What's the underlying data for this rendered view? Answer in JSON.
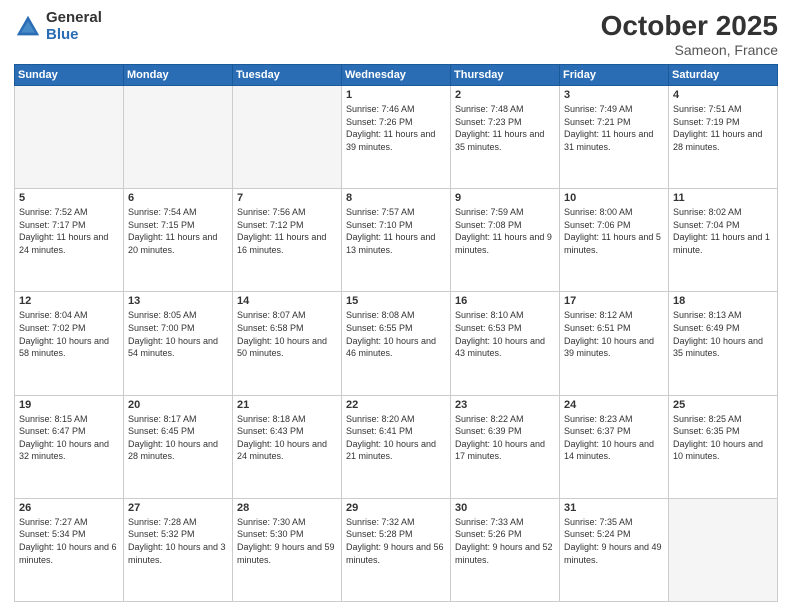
{
  "logo": {
    "general": "General",
    "blue": "Blue"
  },
  "header": {
    "month": "October 2025",
    "location": "Sameon, France"
  },
  "weekdays": [
    "Sunday",
    "Monday",
    "Tuesday",
    "Wednesday",
    "Thursday",
    "Friday",
    "Saturday"
  ],
  "weeks": [
    [
      {
        "day": "",
        "info": ""
      },
      {
        "day": "",
        "info": ""
      },
      {
        "day": "",
        "info": ""
      },
      {
        "day": "1",
        "info": "Sunrise: 7:46 AM\nSunset: 7:26 PM\nDaylight: 11 hours\nand 39 minutes."
      },
      {
        "day": "2",
        "info": "Sunrise: 7:48 AM\nSunset: 7:23 PM\nDaylight: 11 hours\nand 35 minutes."
      },
      {
        "day": "3",
        "info": "Sunrise: 7:49 AM\nSunset: 7:21 PM\nDaylight: 11 hours\nand 31 minutes."
      },
      {
        "day": "4",
        "info": "Sunrise: 7:51 AM\nSunset: 7:19 PM\nDaylight: 11 hours\nand 28 minutes."
      }
    ],
    [
      {
        "day": "5",
        "info": "Sunrise: 7:52 AM\nSunset: 7:17 PM\nDaylight: 11 hours\nand 24 minutes."
      },
      {
        "day": "6",
        "info": "Sunrise: 7:54 AM\nSunset: 7:15 PM\nDaylight: 11 hours\nand 20 minutes."
      },
      {
        "day": "7",
        "info": "Sunrise: 7:56 AM\nSunset: 7:12 PM\nDaylight: 11 hours\nand 16 minutes."
      },
      {
        "day": "8",
        "info": "Sunrise: 7:57 AM\nSunset: 7:10 PM\nDaylight: 11 hours\nand 13 minutes."
      },
      {
        "day": "9",
        "info": "Sunrise: 7:59 AM\nSunset: 7:08 PM\nDaylight: 11 hours\nand 9 minutes."
      },
      {
        "day": "10",
        "info": "Sunrise: 8:00 AM\nSunset: 7:06 PM\nDaylight: 11 hours\nand 5 minutes."
      },
      {
        "day": "11",
        "info": "Sunrise: 8:02 AM\nSunset: 7:04 PM\nDaylight: 11 hours\nand 1 minute."
      }
    ],
    [
      {
        "day": "12",
        "info": "Sunrise: 8:04 AM\nSunset: 7:02 PM\nDaylight: 10 hours\nand 58 minutes."
      },
      {
        "day": "13",
        "info": "Sunrise: 8:05 AM\nSunset: 7:00 PM\nDaylight: 10 hours\nand 54 minutes."
      },
      {
        "day": "14",
        "info": "Sunrise: 8:07 AM\nSunset: 6:58 PM\nDaylight: 10 hours\nand 50 minutes."
      },
      {
        "day": "15",
        "info": "Sunrise: 8:08 AM\nSunset: 6:55 PM\nDaylight: 10 hours\nand 46 minutes."
      },
      {
        "day": "16",
        "info": "Sunrise: 8:10 AM\nSunset: 6:53 PM\nDaylight: 10 hours\nand 43 minutes."
      },
      {
        "day": "17",
        "info": "Sunrise: 8:12 AM\nSunset: 6:51 PM\nDaylight: 10 hours\nand 39 minutes."
      },
      {
        "day": "18",
        "info": "Sunrise: 8:13 AM\nSunset: 6:49 PM\nDaylight: 10 hours\nand 35 minutes."
      }
    ],
    [
      {
        "day": "19",
        "info": "Sunrise: 8:15 AM\nSunset: 6:47 PM\nDaylight: 10 hours\nand 32 minutes."
      },
      {
        "day": "20",
        "info": "Sunrise: 8:17 AM\nSunset: 6:45 PM\nDaylight: 10 hours\nand 28 minutes."
      },
      {
        "day": "21",
        "info": "Sunrise: 8:18 AM\nSunset: 6:43 PM\nDaylight: 10 hours\nand 24 minutes."
      },
      {
        "day": "22",
        "info": "Sunrise: 8:20 AM\nSunset: 6:41 PM\nDaylight: 10 hours\nand 21 minutes."
      },
      {
        "day": "23",
        "info": "Sunrise: 8:22 AM\nSunset: 6:39 PM\nDaylight: 10 hours\nand 17 minutes."
      },
      {
        "day": "24",
        "info": "Sunrise: 8:23 AM\nSunset: 6:37 PM\nDaylight: 10 hours\nand 14 minutes."
      },
      {
        "day": "25",
        "info": "Sunrise: 8:25 AM\nSunset: 6:35 PM\nDaylight: 10 hours\nand 10 minutes."
      }
    ],
    [
      {
        "day": "26",
        "info": "Sunrise: 7:27 AM\nSunset: 5:34 PM\nDaylight: 10 hours\nand 6 minutes."
      },
      {
        "day": "27",
        "info": "Sunrise: 7:28 AM\nSunset: 5:32 PM\nDaylight: 10 hours\nand 3 minutes."
      },
      {
        "day": "28",
        "info": "Sunrise: 7:30 AM\nSunset: 5:30 PM\nDaylight: 9 hours\nand 59 minutes."
      },
      {
        "day": "29",
        "info": "Sunrise: 7:32 AM\nSunset: 5:28 PM\nDaylight: 9 hours\nand 56 minutes."
      },
      {
        "day": "30",
        "info": "Sunrise: 7:33 AM\nSunset: 5:26 PM\nDaylight: 9 hours\nand 52 minutes."
      },
      {
        "day": "31",
        "info": "Sunrise: 7:35 AM\nSunset: 5:24 PM\nDaylight: 9 hours\nand 49 minutes."
      },
      {
        "day": "",
        "info": ""
      }
    ]
  ]
}
